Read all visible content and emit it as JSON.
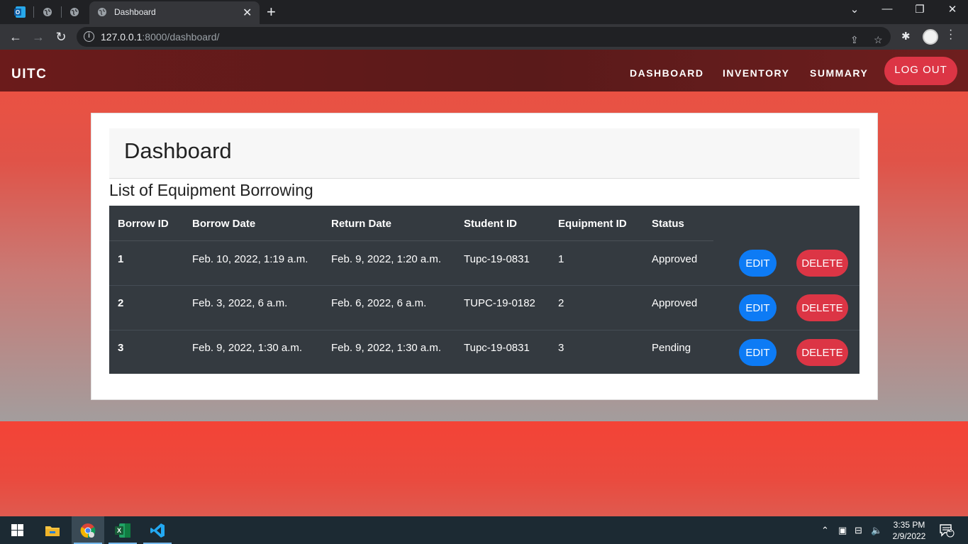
{
  "browser": {
    "tab_title": "Dashboard",
    "url_host": "127.0.0.1",
    "url_path": ":8000/dashboard/"
  },
  "navbar": {
    "brand": "UITC",
    "links": [
      "DASHBOARD",
      "INVENTORY",
      "SUMMARY"
    ],
    "logout": "LOG OUT"
  },
  "card": {
    "title": "Dashboard",
    "subtitle": "List of Equipment Borrowing"
  },
  "table": {
    "headers": [
      "Borrow ID",
      "Borrow Date",
      "Return Date",
      "Student ID",
      "Equipment ID",
      "Status"
    ],
    "rows": [
      [
        "1",
        "Feb. 10, 2022, 1:19 a.m.",
        "Feb. 9, 2022, 1:20 a.m.",
        "Tupc-19-0831",
        "1",
        "Approved"
      ],
      [
        "2",
        "Feb. 3, 2022, 6 a.m.",
        "Feb. 6, 2022, 6 a.m.",
        "TUPC-19-0182",
        "2",
        "Approved"
      ],
      [
        "3",
        "Feb. 9, 2022, 1:30 a.m.",
        "Feb. 9, 2022, 1:30 a.m.",
        "Tupc-19-0831",
        "3",
        "Pending"
      ]
    ],
    "edit_label": "EDIT",
    "delete_label": "DELETE"
  },
  "taskbar": {
    "time": "3:35 PM",
    "date": "2/9/2022",
    "notification_count": "2"
  },
  "colors": {
    "navbar": "#5a1a1a",
    "page": "#f44336",
    "logout": "#dc3545",
    "edit": "#0d7bf5",
    "delete": "#dc3545",
    "table": "#343a40"
  }
}
